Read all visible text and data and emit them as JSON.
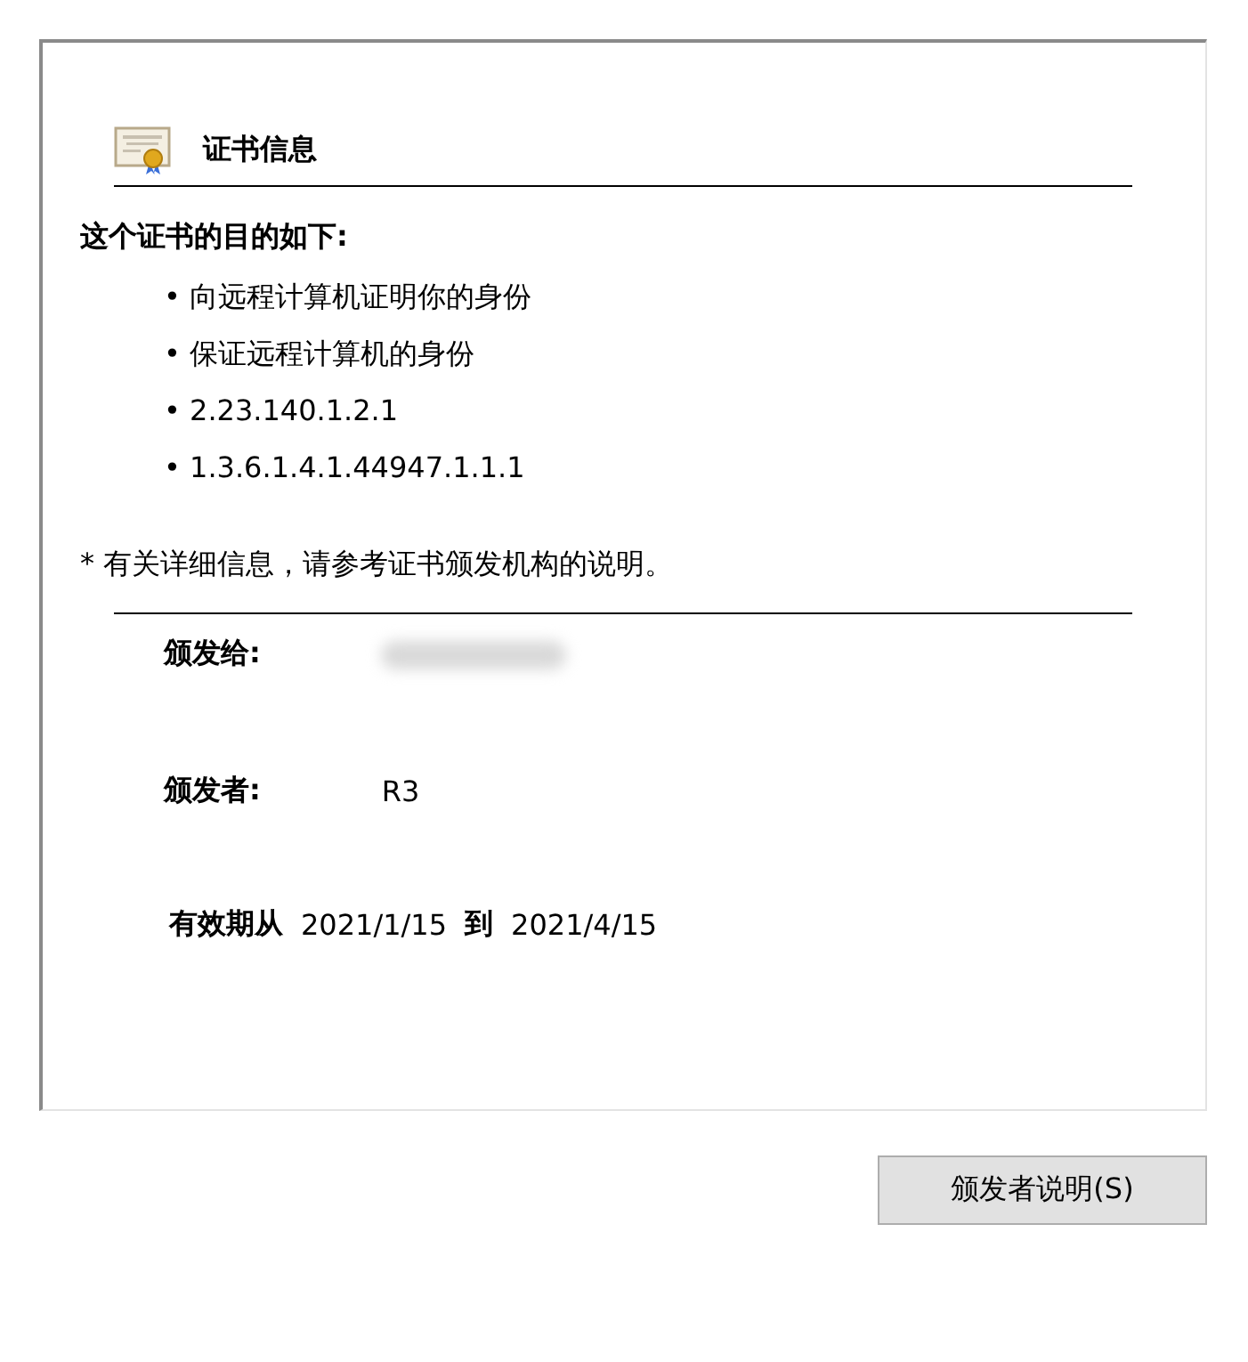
{
  "header": {
    "title": "证书信息"
  },
  "purpose": {
    "heading": "这个证书的目的如下:",
    "items": [
      "• 向远程计算机证明你的身份",
      "• 保证远程计算机的身份",
      "• 2.23.140.1.2.1",
      "• 1.3.6.1.4.1.44947.1.1.1"
    ]
  },
  "note": "* 有关详细信息，请参考证书颁发机构的说明。",
  "issued_to": {
    "label": "颁发给:",
    "redacted": true
  },
  "issued_by": {
    "label": "颁发者:",
    "value": "R3"
  },
  "validity": {
    "from_label": "有效期从",
    "from": "2021/1/15",
    "to_label": "到",
    "to": "2021/4/15"
  },
  "button": "颁发者说明(S)"
}
